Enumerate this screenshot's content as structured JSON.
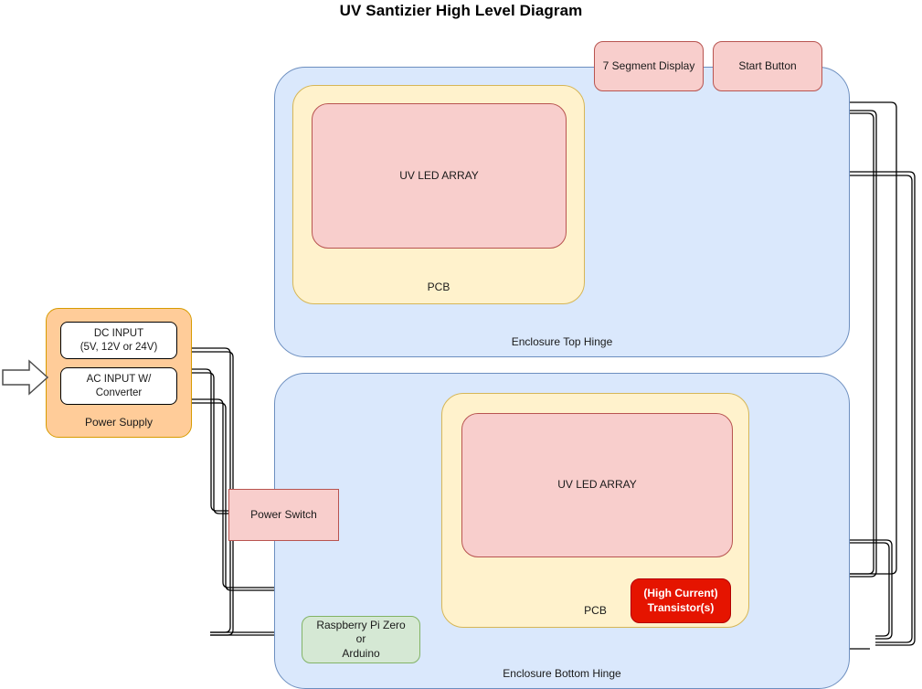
{
  "title": "UV Santizier High Level Diagram",
  "colors": {
    "enclosure_fill": "#dae8fc",
    "enclosure_stroke": "#6c8ebf",
    "pcb_fill": "#fff2cc",
    "pcb_stroke": "#d6b656",
    "led_fill": "#f8cecc",
    "led_stroke": "#b85450",
    "power_fill": "#ffcc99",
    "power_stroke": "#d79b00",
    "mcu_fill": "#d5e8d4",
    "mcu_stroke": "#82b366",
    "transistor_fill": "#e51400",
    "transistor_stroke": "#b20000",
    "wire": "#000000"
  },
  "nodes": {
    "seven_segment_display": {
      "label": "7 Segment Display"
    },
    "start_button": {
      "label": "Start Button"
    },
    "enclosure_top": {
      "label": "Enclosure Top Hinge"
    },
    "enclosure_bottom": {
      "label": "Enclosure Bottom Hinge"
    },
    "pcb_top": {
      "label": "PCB"
    },
    "pcb_bottom": {
      "label": "PCB"
    },
    "led_array_top": {
      "label": "UV LED ARRAY"
    },
    "led_array_bottom": {
      "label": "UV LED ARRAY"
    },
    "power_supply": {
      "label": "Power Supply"
    },
    "dc_input": {
      "label": "DC INPUT\n(5V, 12V or 24V)"
    },
    "ac_input": {
      "label": "AC INPUT W/\nConverter"
    },
    "power_switch": {
      "label": "Power Switch"
    },
    "microcontroller": {
      "label": "Raspberry Pi Zero\nor\nArduino"
    },
    "transistor": {
      "label": "(High Current)\nTransistor(s)"
    }
  },
  "icons": {
    "mains_input_arrow": "block-arrow-right-icon"
  }
}
